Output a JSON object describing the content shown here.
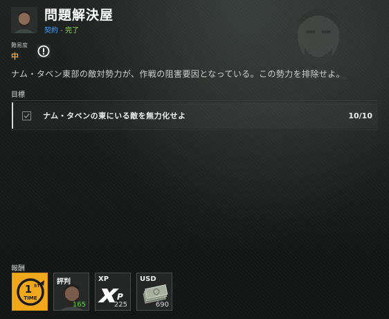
{
  "header": {
    "title": "問題解決屋",
    "type_label": "契約",
    "separator": " - ",
    "status_label": "完了",
    "portrait_icon": "character-portrait"
  },
  "difficulty": {
    "label": "難易度",
    "value": "中",
    "info_icon": "exclamation-circle-icon"
  },
  "description": "ナム・タベン東部の敵対勢力が、作戦の阻害要因となっている。この勢力を排除せよ。",
  "objectives": {
    "title": "目標",
    "items": [
      {
        "text": "ナム・タベンの東にいる敵を無力化せよ",
        "progress": "10/10",
        "completed": true
      }
    ]
  },
  "rewards": {
    "title": "報酬",
    "items": [
      {
        "type": "first-time-badge",
        "label": "",
        "amount": ""
      },
      {
        "type": "reputation",
        "label": "評判",
        "amount": "165"
      },
      {
        "type": "xp",
        "label": "XP",
        "amount": "225"
      },
      {
        "type": "usd",
        "label": "USD",
        "amount": "690"
      }
    ]
  },
  "colors": {
    "accent_blue": "#43a3ff",
    "complete_green": "#8fe24a",
    "difficulty_orange": "#f0a43a",
    "reward_gold": "#f0a81a"
  }
}
